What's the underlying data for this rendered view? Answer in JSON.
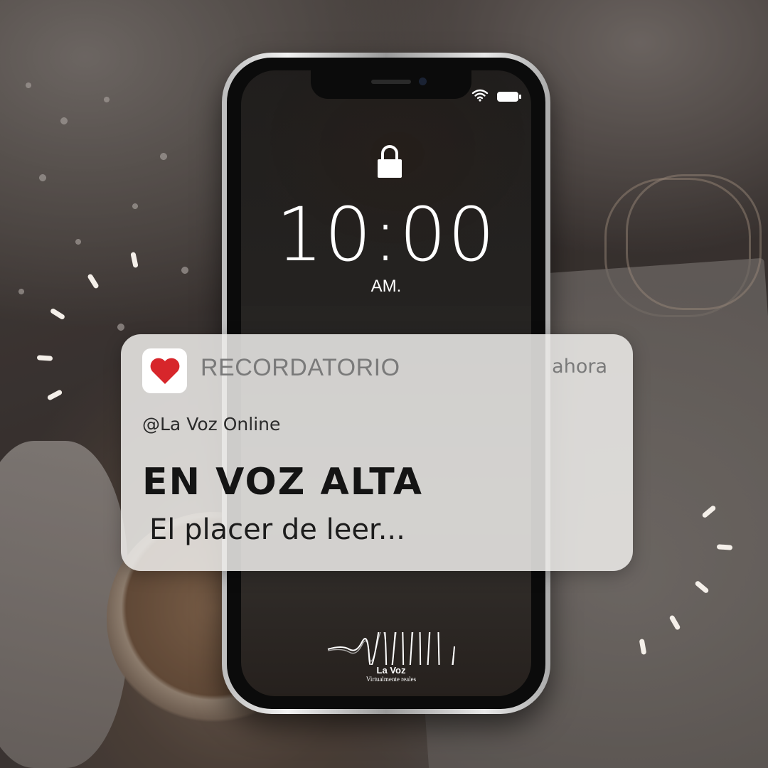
{
  "phone": {
    "time": "10:00",
    "ampm": "AM.",
    "icons": {
      "wifi": "wifi-icon",
      "battery": "battery-icon",
      "lock": "lock-icon"
    }
  },
  "notification": {
    "app_icon": "heart-icon",
    "app_name": "RECORDATORIO",
    "when": "ahora",
    "handle": "@La Voz Online",
    "title": "EN VOZ ALTA",
    "body": "El placer de leer..."
  },
  "brand": {
    "name": "La Voz",
    "tagline": "Virtualmente reales"
  },
  "colors": {
    "heart": "#d7262b",
    "notification_bg": "#eeecea",
    "sparkles": "#f4efe9"
  }
}
